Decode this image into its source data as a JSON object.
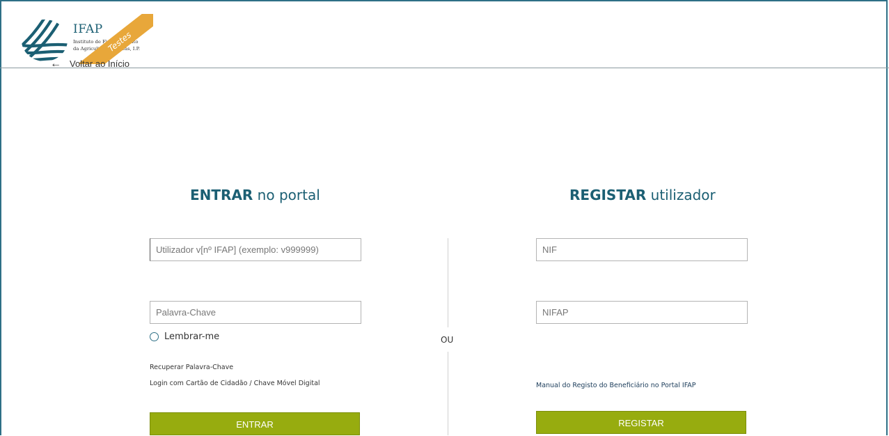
{
  "header": {
    "logo_name": "IFAP",
    "logo_sub_line1": "Instituto de Financiamento",
    "logo_sub_line2": "da Agricultura e Pescas, I.P.",
    "ribbon_label": "Testes",
    "back_link": "Voltar ao Início"
  },
  "login": {
    "title_bold": "ENTRAR",
    "title_rest": " no portal",
    "user_placeholder": "Utilizador v[nº IFAP] (exemplo: v999999)",
    "password_placeholder": "Palavra-Chave",
    "remember_label": "Lembrar-me",
    "recover_link": "Recuperar Palavra-Chave",
    "cc_link": "Login com Cartão de Cidadão / Chave Móvel Digital",
    "submit_label": "ENTRAR"
  },
  "separator": {
    "label": "OU"
  },
  "register": {
    "title_bold": "REGISTAR",
    "title_rest": " utilizador",
    "nif_placeholder": "NIF",
    "nifap_placeholder": "NIFAP",
    "manual_link": "Manual do Registo do Beneficiário no Portal IFAP",
    "submit_label": "REGISTAR"
  },
  "colors": {
    "brand": "#1b5f73",
    "button": "#97ac0f",
    "ribbon": "#e8a73a",
    "frame": "#2e6f86"
  }
}
